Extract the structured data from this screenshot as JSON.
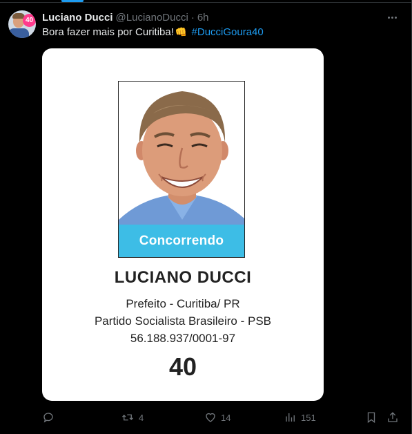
{
  "author": {
    "display_name": "Luciano Ducci",
    "handle": "@LucianoDucci",
    "separator": "·",
    "time": "6h",
    "avatar_badge": "40"
  },
  "tweet": {
    "text_before": "Bora fazer mais por Curitiba!",
    "emoji": "👊",
    "hashtag": "#DucciGoura40"
  },
  "card": {
    "status": "Concorrendo",
    "name": "LUCIANO DUCCI",
    "office": "Prefeito - Curitiba/ PR",
    "party": "Partido Socialista Brasileiro - PSB",
    "cnpj": "56.188.937/0001-97",
    "number": "40"
  },
  "actions": {
    "reply_count": "",
    "retweet_count": "4",
    "like_count": "14",
    "views_count": "151"
  },
  "icons": {
    "reply": "reply-icon",
    "retweet": "retweet-icon",
    "like": "heart-icon",
    "views": "views-icon",
    "bookmark": "bookmark-icon",
    "share": "share-icon",
    "more": "more-icon"
  },
  "colors": {
    "background": "#000000",
    "text": "#e7e9ea",
    "muted": "#71767b",
    "accent": "#1d9bf0",
    "banner": "#3dbde6"
  }
}
